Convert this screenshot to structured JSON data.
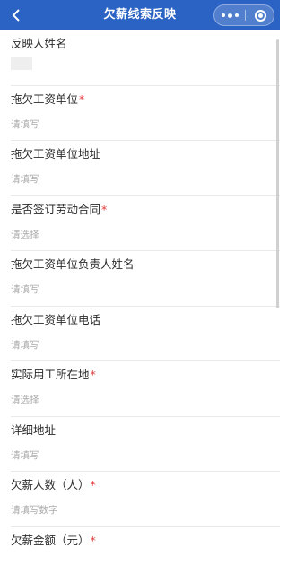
{
  "nav": {
    "title": "欠薪线索反映"
  },
  "fields": [
    {
      "label": "反映人姓名",
      "required": false,
      "value": ""
    },
    {
      "label": "拖欠工资单位",
      "required": true,
      "value": "请填写"
    },
    {
      "label": "拖欠工资单位地址",
      "required": false,
      "value": "请填写"
    },
    {
      "label": "是否签订劳动合同",
      "required": true,
      "value": "请选择"
    },
    {
      "label": "拖欠工资单位负责人姓名",
      "required": false,
      "value": "请填写"
    },
    {
      "label": "拖欠工资单位电话",
      "required": false,
      "value": "请填写"
    },
    {
      "label": "实际用工所在地",
      "required": true,
      "value": "请选择"
    },
    {
      "label": "详细地址",
      "required": false,
      "value": "请填写"
    },
    {
      "label": "欠薪人数（人）",
      "required": true,
      "value": "请填写数字"
    },
    {
      "label": "欠薪金额（元）",
      "required": true,
      "value": ""
    }
  ],
  "required_mark": "*",
  "colors": {
    "navbar": "#2b63c4",
    "required": "#e23b3b",
    "placeholder": "#aaaaaa"
  }
}
